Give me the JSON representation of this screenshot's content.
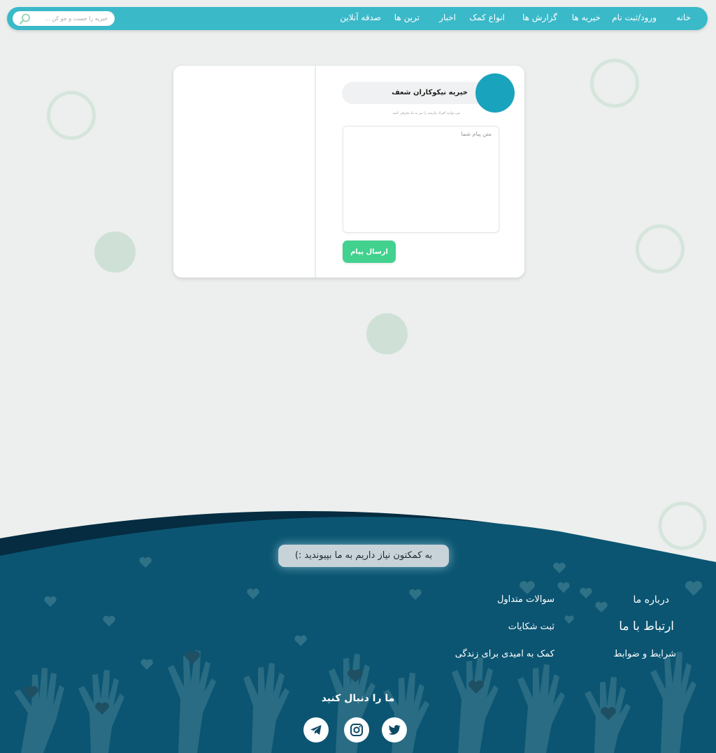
{
  "navbar": {
    "links": [
      "خانه",
      "ورود/ثبت نام",
      "خیریه ها",
      "گزارش ها",
      "انواع کمک",
      "اخبار",
      "ترین ها",
      "صدقه آنلاین"
    ],
    "search_placeholder": "خیریه را جست و جو کن ..."
  },
  "contact": {
    "charity_name": "خیریه نیکوکاران شعف",
    "hint": "می توانید افراد نیازمند را نیز به ما معرفی کنید.",
    "message_placeholder": "متن پیام شما",
    "send_label": "ارسال پیام"
  },
  "footer": {
    "cta": "به کمکتون نیاز داریم به ما بپیوندید :)",
    "col_right": [
      "درباره ما",
      "ارتباط با ما",
      "شرایط و ضوابط"
    ],
    "col_left": [
      "سوالات متداول",
      "ثبت شکایات",
      "کمک به امیدی برای زندگی"
    ],
    "follow_title": "ما را دنبال کنید",
    "social": [
      "telegram-icon",
      "instagram-icon",
      "twitter-icon"
    ]
  },
  "colors": {
    "background": "#ecefed",
    "navbar": "#3ab9c9",
    "avatar": "#1aa3bd",
    "send_button": "#42d18f",
    "footer_dark": "#052c41",
    "footer_main": "#0b5572"
  }
}
